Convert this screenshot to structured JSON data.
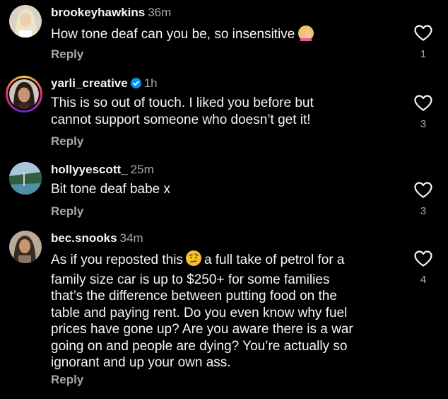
{
  "comments": [
    {
      "username": "brookeyhawkins",
      "time": "36m",
      "text": "How tone deaf can you be, so insensitive",
      "emoji": "woman-facepalming-icon",
      "reply_label": "Reply",
      "likes": "1",
      "verified": false
    },
    {
      "username": "yarli_creative",
      "time": "1h",
      "text_lines": [
        "This is so out of touch. I liked you before but",
        "cannot support someone who doesn’t get it!"
      ],
      "reply_label": "Reply",
      "likes": "3",
      "verified": true,
      "story_ring": true
    },
    {
      "username": "hollyyescott_",
      "time": "25m",
      "text": "Bit tone deaf babe x",
      "reply_label": "Reply",
      "likes": "3",
      "verified": false
    },
    {
      "username": "bec.snooks",
      "time": "34m",
      "text_first": "As if you reposted this",
      "text_first_after": "a full take of petrol for a",
      "text_lines": [
        "family size car is up to $250+ for some families",
        "that’s the difference between putting food on the",
        "table and paying rent. Do you even know why fuel",
        "prices have gone up? Are you aware there is a war",
        "going on and people are dying? You’re actually so",
        "ignorant and up your own ass."
      ],
      "emoji": "face-with-raised-eyebrow-icon",
      "reply_label": "Reply",
      "likes": "4",
      "verified": false
    }
  ],
  "colors": {
    "background": "#000000",
    "text": "#f5f5f5",
    "muted": "#a8a8a8",
    "verified": "#0095f6"
  }
}
